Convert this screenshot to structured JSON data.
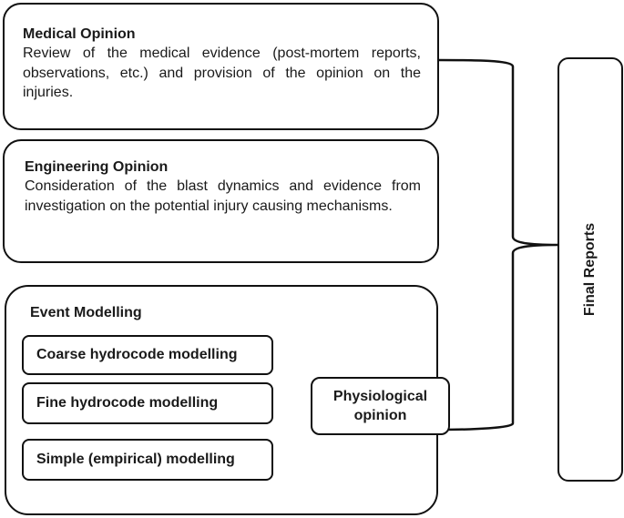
{
  "diagram": {
    "medical_opinion": {
      "title": "Medical Opinion",
      "description": "Review of the medical evidence (post-mortem reports, observations, etc.) and provision of the opinion on the injuries."
    },
    "engineering_opinion": {
      "title": "Engineering Opinion",
      "description": "Consideration of the blast dynamics and evidence from investigation on the potential injury causing mechanisms."
    },
    "event_modelling": {
      "title": "Event Modelling",
      "methods": [
        "Coarse hydrocode modelling",
        "Fine hydrocode modelling",
        "Simple (empirical) modelling"
      ],
      "output": "Physiological opinion"
    },
    "final": {
      "label": "Final Reports"
    }
  }
}
